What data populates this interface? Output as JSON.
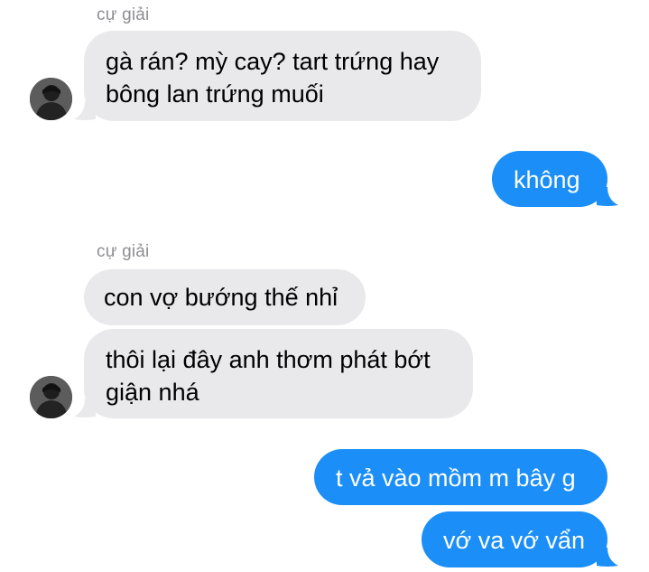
{
  "conversation": {
    "messages": [
      {
        "direction": "incoming",
        "sender": "cự giải",
        "text": "gà rán? mỳ cay? tart trứng hay\nbông lan trứng muối"
      },
      {
        "direction": "outgoing",
        "text": "không"
      },
      {
        "direction": "incoming",
        "sender": "cự giải",
        "text": "con vợ bướng thế nhỉ"
      },
      {
        "direction": "incoming",
        "text": "thôi lại đây anh thơm phát bớt\ngiận nhá"
      },
      {
        "direction": "outgoing",
        "text": "t vả vào mồm m bây g"
      },
      {
        "direction": "outgoing",
        "text": "vớ va vớ vẩn"
      }
    ],
    "avatar_icon": "user-avatar",
    "colors": {
      "incoming_bubble": "#e9e9eb",
      "outgoing_bubble": "#1b8ef7",
      "sender_name": "#8e8e93"
    }
  }
}
